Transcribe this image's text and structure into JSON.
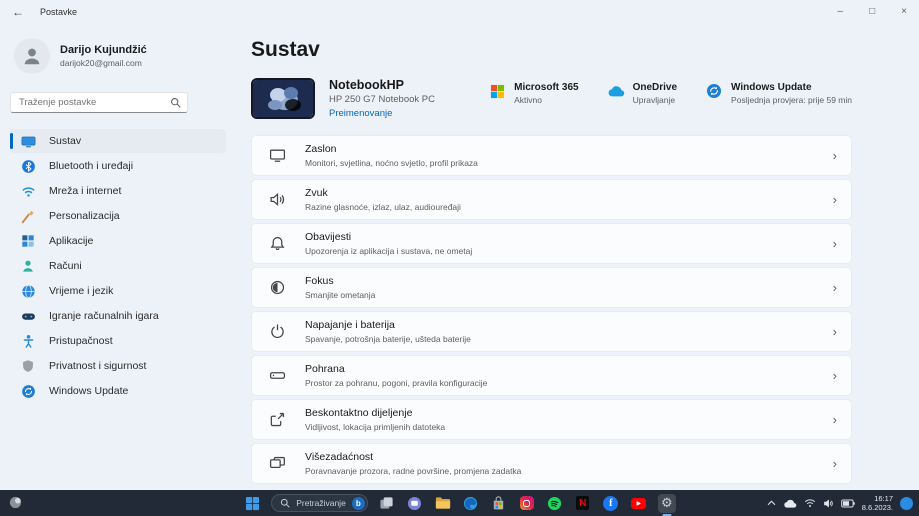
{
  "window": {
    "title": "Postavke",
    "controls": {
      "minimize": "–",
      "maximize": "□",
      "close": "×"
    },
    "back": "←"
  },
  "user": {
    "name": "Darijo Kujundžić",
    "email": "darijok20@gmail.com"
  },
  "search": {
    "placeholder": "Traženje postavke"
  },
  "sidebar": {
    "items": [
      {
        "label": "Sustav",
        "icon": "system-icon",
        "selected": true
      },
      {
        "label": "Bluetooth i uređaji",
        "icon": "bluetooth-icon",
        "selected": false
      },
      {
        "label": "Mreža i internet",
        "icon": "network-icon",
        "selected": false
      },
      {
        "label": "Personalizacija",
        "icon": "personalization-icon",
        "selected": false
      },
      {
        "label": "Aplikacije",
        "icon": "apps-icon",
        "selected": false
      },
      {
        "label": "Računi",
        "icon": "accounts-icon",
        "selected": false
      },
      {
        "label": "Vrijeme i jezik",
        "icon": "time-language-icon",
        "selected": false
      },
      {
        "label": "Igranje računalnih igara",
        "icon": "gaming-icon",
        "selected": false
      },
      {
        "label": "Pristupačnost",
        "icon": "accessibility-icon",
        "selected": false
      },
      {
        "label": "Privatnost i sigurnost",
        "icon": "privacy-icon",
        "selected": false
      },
      {
        "label": "Windows Update",
        "icon": "windows-update-icon",
        "selected": false
      }
    ]
  },
  "main": {
    "title": "Sustav",
    "device": {
      "name": "NotebookHP",
      "model": "HP 250 G7 Notebook PC",
      "rename_link": "Preimenovanje"
    },
    "status": [
      {
        "title": "Microsoft 365",
        "subtitle": "Aktivno",
        "icon": "microsoft-logo"
      },
      {
        "title": "OneDrive",
        "subtitle": "Upravljanje",
        "icon": "onedrive-icon"
      },
      {
        "title": "Windows Update",
        "subtitle": "Posljednja provjera: prije 59 min",
        "icon": "windows-update-icon"
      }
    ],
    "rows": [
      {
        "title": "Zaslon",
        "subtitle": "Monitori, svjetlina, noćno svjetlo, profil prikaza",
        "icon": "display-icon"
      },
      {
        "title": "Zvuk",
        "subtitle": "Razine glasnoće, izlaz, ulaz, audiouređaji",
        "icon": "sound-icon"
      },
      {
        "title": "Obavijesti",
        "subtitle": "Upozorenja iz aplikacija i sustava, ne ometaj",
        "icon": "notifications-icon"
      },
      {
        "title": "Fokus",
        "subtitle": "Smanjite ometanja",
        "icon": "focus-icon"
      },
      {
        "title": "Napajanje i baterija",
        "subtitle": "Spavanje, potrošnja baterije, ušteda baterije",
        "icon": "power-icon"
      },
      {
        "title": "Pohrana",
        "subtitle": "Prostor za pohranu, pogoni, pravila konfiguracije",
        "icon": "storage-icon"
      },
      {
        "title": "Beskontaktno dijeljenje",
        "subtitle": "Vidljivost, lokacija primljenih datoteka",
        "icon": "nearby-share-icon"
      },
      {
        "title": "Višezadaćnost",
        "subtitle": "Poravnavanje prozora, radne površine, promjena zadatka",
        "icon": "multitasking-icon"
      }
    ],
    "chevron": "›"
  },
  "taskbar": {
    "search_placeholder": "Pretraživanje",
    "apps": [
      "start",
      "search",
      "task-view",
      "chat",
      "file-explorer",
      "edge",
      "store",
      "instagram",
      "spotify",
      "netflix",
      "facebook",
      "youtube",
      "settings"
    ],
    "active_app": "settings",
    "facebook_glyph": "f",
    "netflix_glyph": "N",
    "youtube_glyph": "▶",
    "bing_glyph": "b",
    "gear_glyph": "⚙",
    "tray": {
      "time": "16:17",
      "date": "8.6.2023."
    }
  },
  "colors": {
    "accent": "#0067c0",
    "link": "#0067c0",
    "taskbar_bg": "#212a36",
    "card_bg": "#fbfcfe"
  }
}
